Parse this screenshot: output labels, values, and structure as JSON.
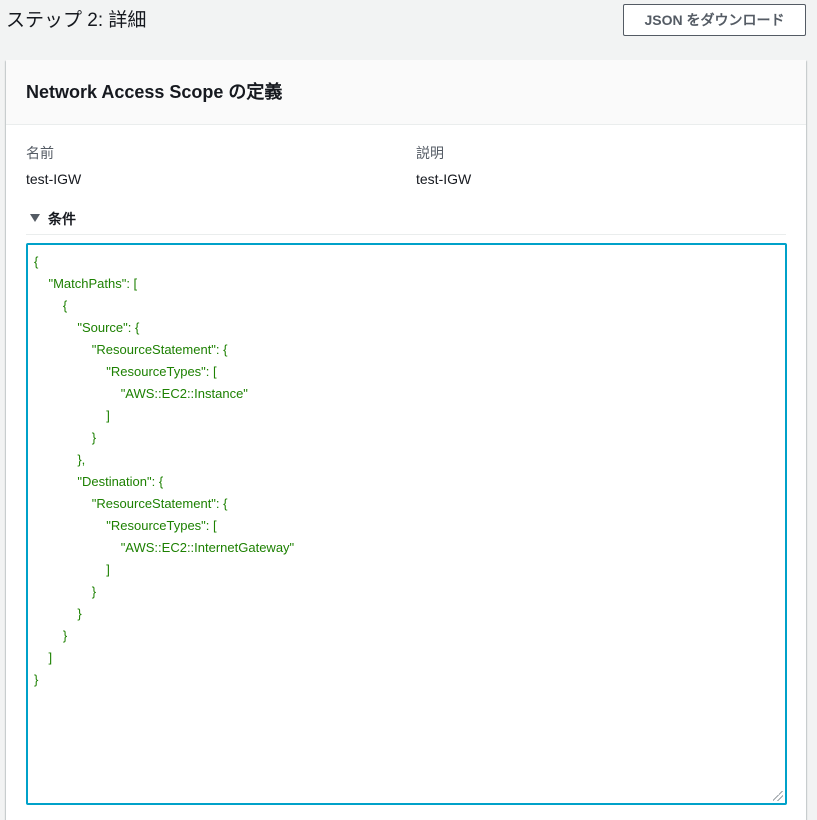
{
  "page": {
    "title": "ステップ 2: 詳細",
    "download_button_label": "JSON をダウンロード"
  },
  "container": {
    "title": "Network Access Scope の定義",
    "name_label": "名前",
    "name_value": "test-IGW",
    "description_label": "説明",
    "description_value": "test-IGW",
    "conditions_label": "条件",
    "conditions_expanded": true,
    "conditions_json": "{\n\t\"MatchPaths\": [\n\t\t{\n\t\t\t\"Source\": {\n\t\t\t\t\"ResourceStatement\": {\n\t\t\t\t\t\"ResourceTypes\": [\n\t\t\t\t\t\t\"AWS::EC2::Instance\"\n\t\t\t\t\t]\n\t\t\t\t}\n\t\t\t},\n\t\t\t\"Destination\": {\n\t\t\t\t\"ResourceStatement\": {\n\t\t\t\t\t\"ResourceTypes\": [\n\t\t\t\t\t\t\"AWS::EC2::InternetGateway\"\n\t\t\t\t\t]\n\t\t\t\t}\n\t\t\t}\n\t\t}\n\t]\n}"
  },
  "icons": {
    "expander": "caret-down-icon",
    "resize": "resize-grip-icon"
  },
  "colors": {
    "page_background": "#f2f3f3",
    "focus_border": "#00a1c9",
    "code_text": "#1d8102",
    "button_border": "#545b64"
  }
}
